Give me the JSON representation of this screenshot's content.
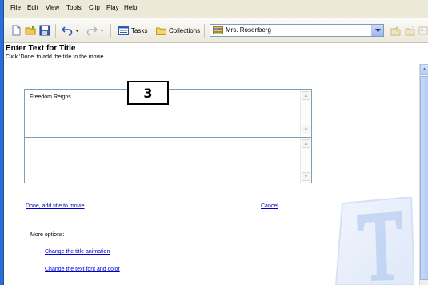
{
  "menu": {
    "items": [
      "File",
      "Edit",
      "View",
      "Tools",
      "Clip",
      "Play",
      "Help"
    ]
  },
  "toolbar": {
    "tasks_label": "Tasks",
    "collections_label": "Collections",
    "collection_combo_value": "Mrs. Rosenberg"
  },
  "task": {
    "title": "Enter Text for Title",
    "subtitle": "Click 'Done' to add the title to the movie."
  },
  "editor": {
    "line1_text": "Freedom Reigns",
    "line2_text": ""
  },
  "callout": {
    "number": "3"
  },
  "actions": {
    "done_label": "Done, add title to movie",
    "cancel_label": "Cancel",
    "more_options_label": "More options:",
    "change_animation_label": "Change the title animation",
    "change_font_label": "Change the text font and color"
  },
  "icons": {
    "new": "new-project-icon",
    "open": "open-folder-icon",
    "save": "save-icon",
    "undo": "undo-icon",
    "redo": "redo-icon",
    "tasks": "tasks-icon",
    "collections": "collections-folder-icon",
    "collection_combo": "collection-icon",
    "watermark": "title-T-icon"
  },
  "colors": {
    "link": "#0000cc",
    "accent": "#2a6fd6",
    "input_border": "#7f9db9"
  }
}
